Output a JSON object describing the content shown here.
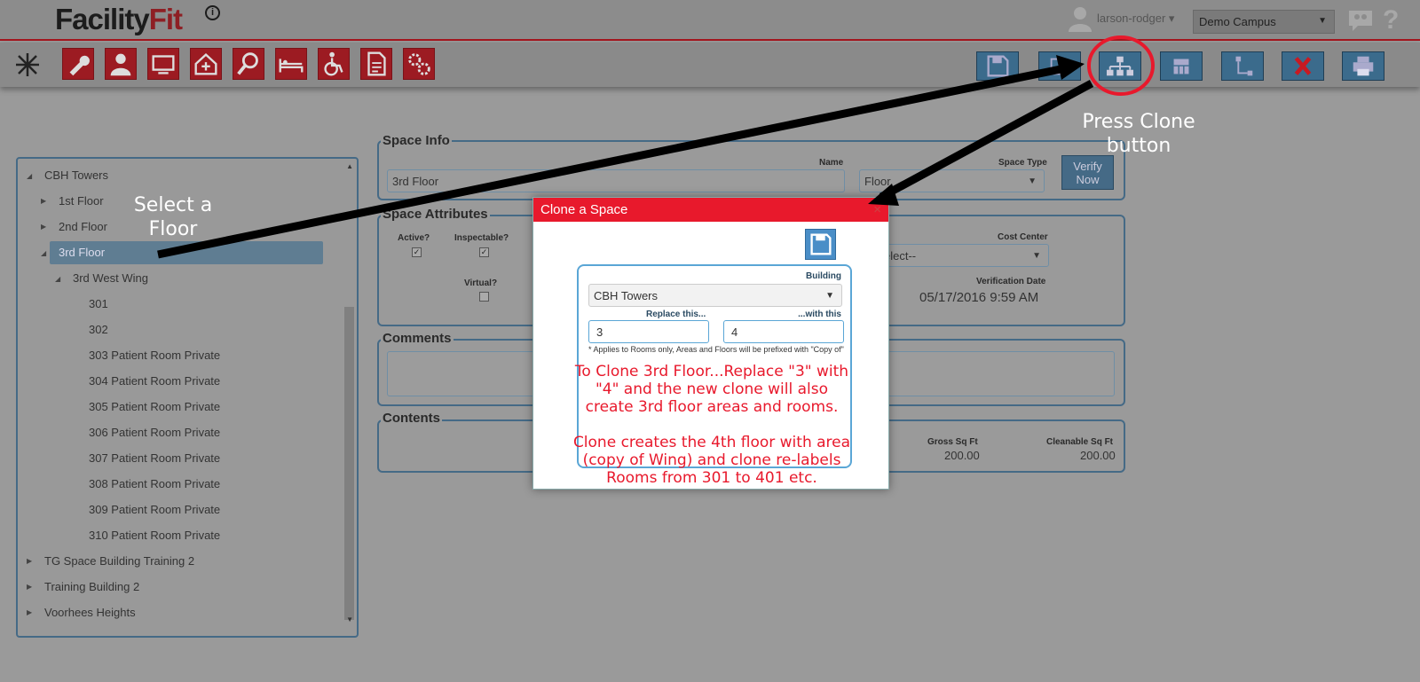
{
  "header": {
    "logo_main": "Facility",
    "logo_fit": "Fit",
    "logo_info": "i",
    "user": "larson-rodger ▾",
    "campus": "Demo Campus",
    "help": "?"
  },
  "tree": {
    "items": [
      {
        "label": "CBH Towers"
      },
      {
        "label": "1st Floor"
      },
      {
        "label": "2nd Floor"
      },
      {
        "label": "3rd Floor"
      },
      {
        "label": "3rd West Wing"
      },
      {
        "label": "301"
      },
      {
        "label": "302"
      },
      {
        "label": "303 Patient Room Private"
      },
      {
        "label": "304 Patient Room Private"
      },
      {
        "label": "305 Patient Room Private"
      },
      {
        "label": "306 Patient Room Private"
      },
      {
        "label": "307 Patient Room Private"
      },
      {
        "label": "308 Patient Room Private"
      },
      {
        "label": "309 Patient Room Private"
      },
      {
        "label": "310 Patient Room Private"
      },
      {
        "label": "TG Space Building Training 2"
      },
      {
        "label": "Training Building 2"
      },
      {
        "label": "Voorhees Heights"
      }
    ]
  },
  "space_info": {
    "title": "Space Info",
    "name_label": "Name",
    "name_value": "3rd Floor",
    "type_label": "Space Type",
    "type_value": "Floor",
    "verify_label": "Verify Now"
  },
  "space_attributes": {
    "title": "Space Attributes",
    "active_label": "Active?",
    "inspectable_label": "Inspectable?",
    "virtual_label": "Virtual?",
    "cost_center_label": "Cost Center",
    "cost_center_value": "elect--",
    "verification_label": "Verification Date",
    "verification_value": "05/17/2016 9:59 AM"
  },
  "comments": {
    "title": "Comments"
  },
  "contents": {
    "title": "Contents",
    "gross_label": "Gross Sq Ft",
    "gross_value": "200.00",
    "cleanable_label": "Cleanable Sq Ft",
    "cleanable_value": "200.00"
  },
  "modal": {
    "title": "Clone a Space",
    "close": "×",
    "building_label": "Building",
    "building_value": "CBH Towers",
    "replace_label": "Replace this...",
    "replace_value": "3",
    "with_label": "...with this",
    "with_value": "4",
    "note": "* Applies to Rooms only, Areas and Floors will be prefixed with \"Copy of\"",
    "annotation_1": "To Clone 3rd Floor...Replace \"3\" with \"4\" and the new clone will also create 3rd floor areas and rooms.",
    "annotation_2": "Clone creates the 4th floor with area (copy of Wing) and clone re-labels Rooms from 301 to 401 etc."
  },
  "callouts": {
    "select_floor": "Select a Floor",
    "press_clone": "Press Clone button"
  },
  "colors": {
    "accent_red": "#e8192c",
    "toolbar_red": "#9c1b22",
    "toolbar_blue": "#3b6b8c",
    "border_blue": "#456a86"
  }
}
